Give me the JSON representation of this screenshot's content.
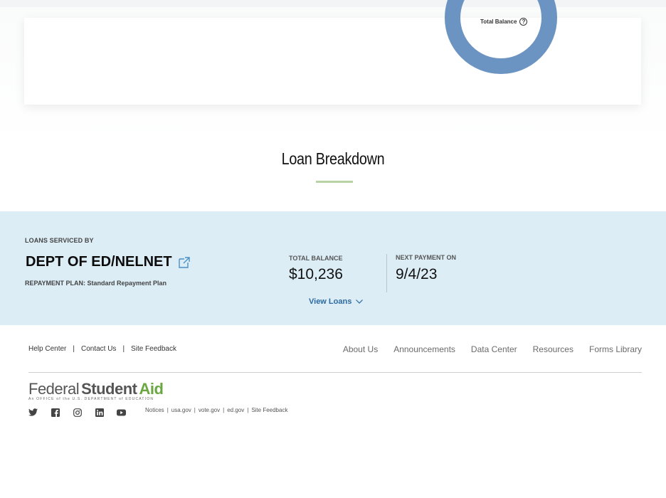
{
  "summary_card": {
    "donut_label": "Total Balance",
    "donut_color": "#6b94c2"
  },
  "section": {
    "title": "Loan Breakdown"
  },
  "loan": {
    "serviced_label": "LOANS SERVICED BY",
    "servicer_name": "DEPT OF ED/NELNET",
    "repayment_plan": "REPAYMENT PLAN: Standard Repayment Plan",
    "total_balance_label": "TOTAL BALANCE",
    "total_balance_value": "$10,236",
    "next_payment_label": "NEXT PAYMENT ON",
    "next_payment_value": "9/4/23",
    "view_loans_label": "View Loans"
  },
  "footer": {
    "left_links": [
      "Help Center",
      "Contact Us",
      "Site Feedback"
    ],
    "separator": "|",
    "right_links": [
      "About Us",
      "Announcements",
      "Data Center",
      "Resources",
      "Forms Library"
    ],
    "logo_federal": "Federal",
    "logo_student": "Student",
    "logo_aid": "Aid",
    "logo_tagline": "An OFFICE of the U.S. DEPARTMENT of EDUCATION",
    "social_icons": [
      "twitter-icon",
      "facebook-icon",
      "instagram-icon",
      "linkedin-icon",
      "youtube-icon"
    ],
    "legal_links": [
      "Notices",
      "usa.gov",
      "vote.gov",
      "ed.gov",
      "Site Feedback"
    ]
  },
  "colors": {
    "band_bg": "#dcedf6",
    "accent_green": "#6aa743",
    "link_blue": "#2c6aa0"
  }
}
